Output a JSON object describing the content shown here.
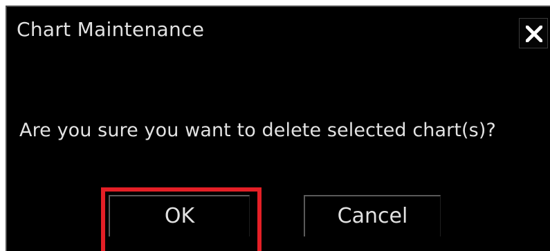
{
  "dialog": {
    "title": "Chart Maintenance",
    "message": "Are you sure you want to delete selected chart(s)?",
    "close_icon": "close-icon",
    "buttons": {
      "ok_label": "OK",
      "cancel_label": "Cancel"
    }
  },
  "colors": {
    "dialog_background": "#000000",
    "text": "#e2e2e2",
    "highlight": "#e41f26"
  }
}
